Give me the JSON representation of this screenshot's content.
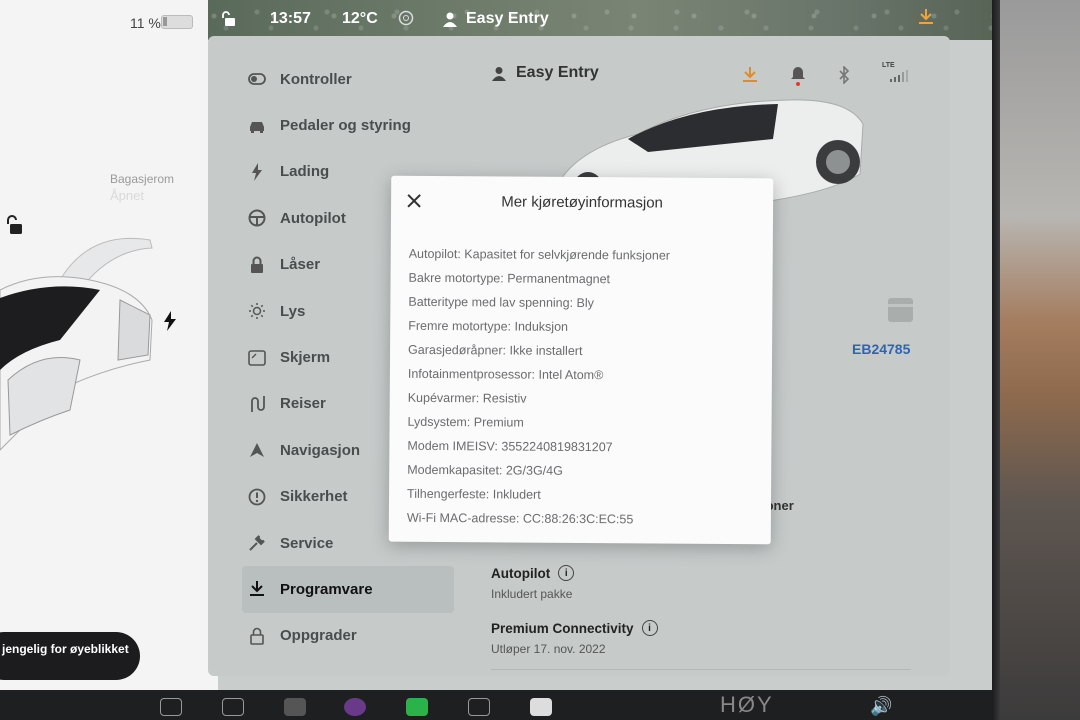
{
  "statusbar": {
    "time": "13:57",
    "temperature": "12°C",
    "profile": "Easy Entry"
  },
  "left_panel": {
    "battery_percent": "11 %",
    "trunk_label": "Bagasjerom",
    "trunk_status": "Åpnet",
    "toast": "jengelig for øyeblikket"
  },
  "nav": {
    "items": [
      {
        "label": "Kontroller",
        "icon": "toggle-icon"
      },
      {
        "label": "Pedaler og styring",
        "icon": "car-icon"
      },
      {
        "label": "Lading",
        "icon": "bolt-icon"
      },
      {
        "label": "Autopilot",
        "icon": "steering-wheel-icon"
      },
      {
        "label": "Låser",
        "icon": "lock-icon"
      },
      {
        "label": "Lys",
        "icon": "sun-icon"
      },
      {
        "label": "Skjerm",
        "icon": "screen-icon"
      },
      {
        "label": "Reiser",
        "icon": "route-icon"
      },
      {
        "label": "Navigasjon",
        "icon": "navigation-arrow-icon"
      },
      {
        "label": "Sikkerhet",
        "icon": "alert-circle-icon"
      },
      {
        "label": "Service",
        "icon": "wrench-icon"
      },
      {
        "label": "Programvare",
        "icon": "download-icon",
        "active": true
      },
      {
        "label": "Oppgrader",
        "icon": "padlock-icon"
      }
    ]
  },
  "main": {
    "profile_name": "Easy Entry",
    "vin_suffix": "EB24785",
    "partial_text": "joner",
    "autopilot": {
      "title": "Autopilot",
      "subtitle": "Inkludert pakke"
    },
    "premium": {
      "title": "Premium Connectivity",
      "subtitle": "Utløper 17. nov. 2022"
    }
  },
  "modal": {
    "title": "Mer kjøretøyinformasjon",
    "rows": [
      "Autopilot: Kapasitet for selvkjørende funksjoner",
      "Bakre motortype: Permanentmagnet",
      "Batteritype med lav spenning: Bly",
      "Fremre motortype: Induksjon",
      "Garasjedøråpner: Ikke installert",
      "Infotainmentprosessor: Intel Atom®",
      "Kupévarmer: Resistiv",
      "Lydsystem: Premium",
      "Modem IMEISV: 3552240819831207",
      "Modemkapasitet: 2G/3G/4G",
      "Tilhengerfeste: Inkludert",
      "Wi-Fi MAC-adresse: CC:88:26:3C:EC:55"
    ]
  },
  "header_icons": {
    "lte_label": "LTE"
  },
  "dock": {
    "volume_label": "HØY"
  },
  "colors": {
    "accent_blue": "#2f65b0",
    "download_orange": "#e08a2a",
    "alert_red": "#e23b2e"
  }
}
